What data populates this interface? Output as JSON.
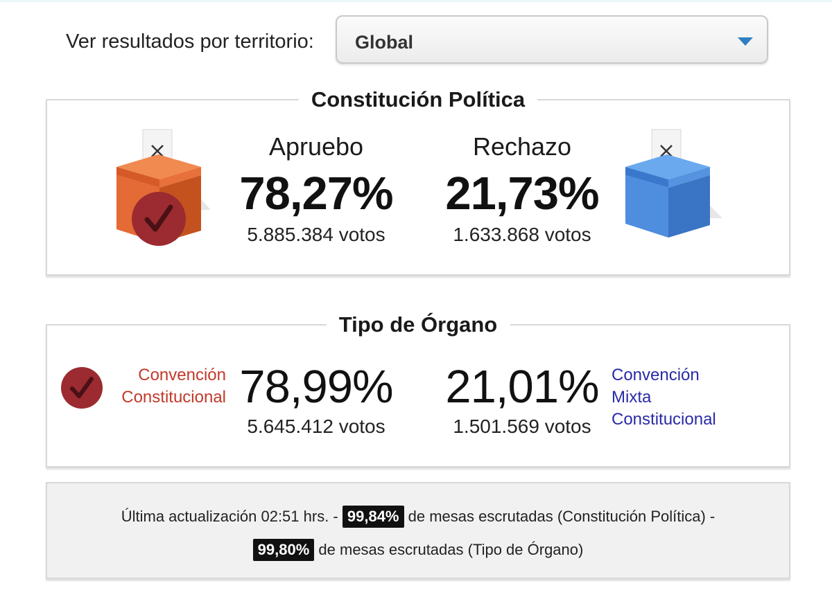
{
  "territory": {
    "label": "Ver resultados por territorio:",
    "selected": "Global"
  },
  "constitution": {
    "title": "Constitución Política",
    "apruebo": {
      "name": "Apruebo",
      "percent": "78,27%",
      "votes": "5.885.384 votos",
      "color": "#e8673a",
      "winner": true
    },
    "rechazo": {
      "name": "Rechazo",
      "percent": "21,73%",
      "votes": "1.633.868 votos",
      "color": "#4a8fe0",
      "winner": false
    }
  },
  "organ": {
    "title": "Tipo de Órgano",
    "convencion": {
      "name_line1": "Convención",
      "name_line2": "Constitucional",
      "percent": "78,99%",
      "votes": "5.645.412 votos",
      "color": "#c23a2b",
      "winner": true
    },
    "mixta": {
      "name_line1": "Convención",
      "name_line2": "Mixta",
      "name_line3": "Constitucional",
      "percent": "21,01%",
      "votes": "1.501.569 votos",
      "color": "#2a2aa8",
      "winner": false
    }
  },
  "footer": {
    "update_text": "Última actualización 02:51 hrs. -",
    "pct1": "99,84%",
    "text1": "de mesas escrutadas (Constitución Política) -",
    "pct2": "99,80%",
    "text2": "de mesas escrutadas (Tipo de Órgano)"
  },
  "icons": {
    "ballot_box_orange": "ballot-box-icon",
    "ballot_box_blue": "ballot-box-icon",
    "check": "check-icon",
    "dropdown": "chevron-down-icon"
  }
}
